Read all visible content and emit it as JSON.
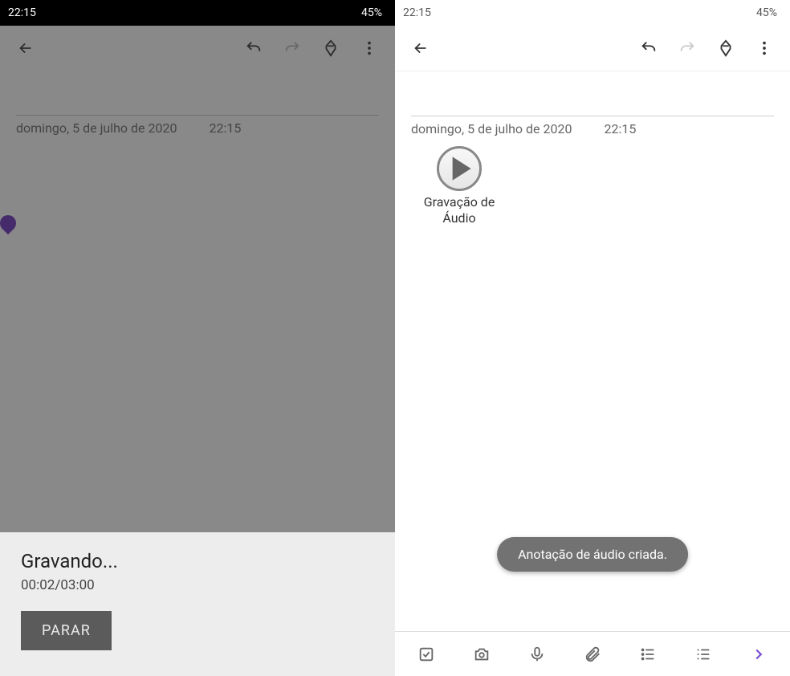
{
  "status": {
    "time": "22:15",
    "battery": "45%"
  },
  "note": {
    "date": "domingo, 5 de julho de 2020",
    "time": "22:15"
  },
  "recording": {
    "status": "Gravando...",
    "elapsed_total": "00:02/03:00",
    "stop_label": "PARAR"
  },
  "playback": {
    "label_line1": "Gravação de",
    "label_line2": "Áudio"
  },
  "toast": {
    "message": "Anotação de áudio criada."
  }
}
